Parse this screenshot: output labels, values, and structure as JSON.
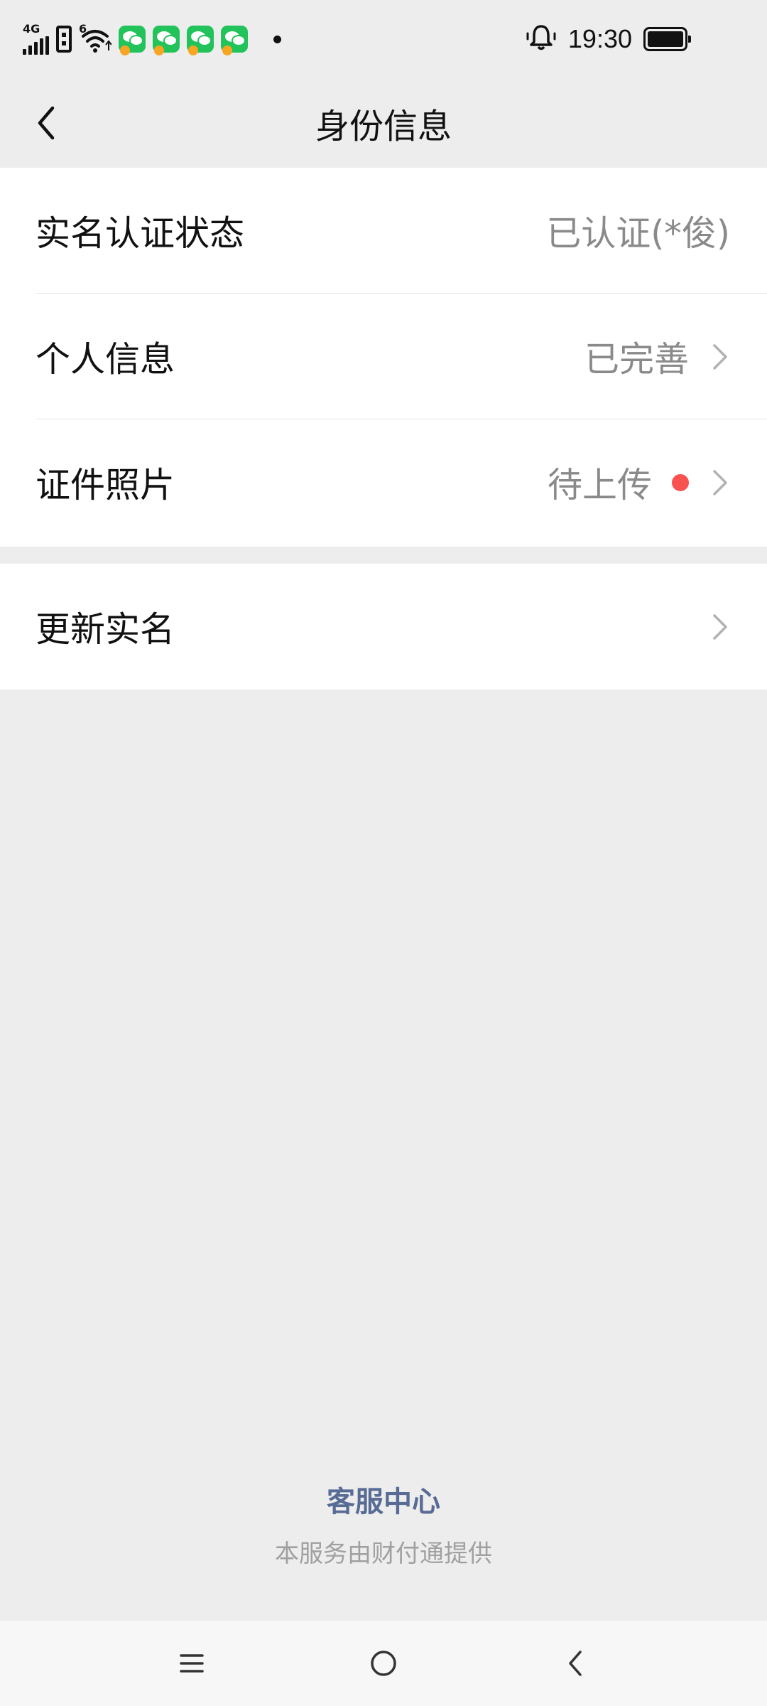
{
  "status_bar": {
    "network": "4G",
    "wifi_label": "6",
    "time": "19:30",
    "icons": [
      "signal-icon",
      "sim-icon",
      "wifi-icon",
      "wechat-icon",
      "wechat-icon",
      "wechat-icon",
      "wechat-icon",
      "notification-dot-icon",
      "alarm-bell-icon",
      "battery-icon"
    ]
  },
  "nav": {
    "title": "身份信息",
    "back_icon": "chevron-left-icon"
  },
  "section1": {
    "rows": [
      {
        "label": "实名认证状态",
        "value": "已认证(*俊)"
      },
      {
        "label": "个人信息",
        "value": "已完善"
      },
      {
        "label": "证件照片",
        "value": "待上传"
      }
    ]
  },
  "section2": {
    "rows": [
      {
        "label": "更新实名",
        "value": ""
      }
    ]
  },
  "footer": {
    "link": "客服中心",
    "note": "本服务由财付通提供"
  },
  "colors": {
    "background": "#ededed",
    "accent_link": "#576b95",
    "red_dot": "#fa5151",
    "wechat_green": "#21c35a"
  }
}
